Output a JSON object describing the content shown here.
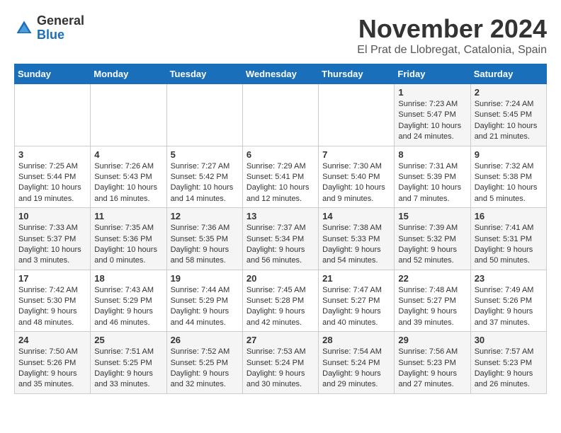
{
  "header": {
    "logo_general": "General",
    "logo_blue": "Blue",
    "month_title": "November 2024",
    "location": "El Prat de Llobregat, Catalonia, Spain"
  },
  "days_of_week": [
    "Sunday",
    "Monday",
    "Tuesday",
    "Wednesday",
    "Thursday",
    "Friday",
    "Saturday"
  ],
  "weeks": [
    [
      {
        "day": "",
        "info": ""
      },
      {
        "day": "",
        "info": ""
      },
      {
        "day": "",
        "info": ""
      },
      {
        "day": "",
        "info": ""
      },
      {
        "day": "",
        "info": ""
      },
      {
        "day": "1",
        "info": "Sunrise: 7:23 AM\nSunset: 5:47 PM\nDaylight: 10 hours and 24 minutes."
      },
      {
        "day": "2",
        "info": "Sunrise: 7:24 AM\nSunset: 5:45 PM\nDaylight: 10 hours and 21 minutes."
      }
    ],
    [
      {
        "day": "3",
        "info": "Sunrise: 7:25 AM\nSunset: 5:44 PM\nDaylight: 10 hours and 19 minutes."
      },
      {
        "day": "4",
        "info": "Sunrise: 7:26 AM\nSunset: 5:43 PM\nDaylight: 10 hours and 16 minutes."
      },
      {
        "day": "5",
        "info": "Sunrise: 7:27 AM\nSunset: 5:42 PM\nDaylight: 10 hours and 14 minutes."
      },
      {
        "day": "6",
        "info": "Sunrise: 7:29 AM\nSunset: 5:41 PM\nDaylight: 10 hours and 12 minutes."
      },
      {
        "day": "7",
        "info": "Sunrise: 7:30 AM\nSunset: 5:40 PM\nDaylight: 10 hours and 9 minutes."
      },
      {
        "day": "8",
        "info": "Sunrise: 7:31 AM\nSunset: 5:39 PM\nDaylight: 10 hours and 7 minutes."
      },
      {
        "day": "9",
        "info": "Sunrise: 7:32 AM\nSunset: 5:38 PM\nDaylight: 10 hours and 5 minutes."
      }
    ],
    [
      {
        "day": "10",
        "info": "Sunrise: 7:33 AM\nSunset: 5:37 PM\nDaylight: 10 hours and 3 minutes."
      },
      {
        "day": "11",
        "info": "Sunrise: 7:35 AM\nSunset: 5:36 PM\nDaylight: 10 hours and 0 minutes."
      },
      {
        "day": "12",
        "info": "Sunrise: 7:36 AM\nSunset: 5:35 PM\nDaylight: 9 hours and 58 minutes."
      },
      {
        "day": "13",
        "info": "Sunrise: 7:37 AM\nSunset: 5:34 PM\nDaylight: 9 hours and 56 minutes."
      },
      {
        "day": "14",
        "info": "Sunrise: 7:38 AM\nSunset: 5:33 PM\nDaylight: 9 hours and 54 minutes."
      },
      {
        "day": "15",
        "info": "Sunrise: 7:39 AM\nSunset: 5:32 PM\nDaylight: 9 hours and 52 minutes."
      },
      {
        "day": "16",
        "info": "Sunrise: 7:41 AM\nSunset: 5:31 PM\nDaylight: 9 hours and 50 minutes."
      }
    ],
    [
      {
        "day": "17",
        "info": "Sunrise: 7:42 AM\nSunset: 5:30 PM\nDaylight: 9 hours and 48 minutes."
      },
      {
        "day": "18",
        "info": "Sunrise: 7:43 AM\nSunset: 5:29 PM\nDaylight: 9 hours and 46 minutes."
      },
      {
        "day": "19",
        "info": "Sunrise: 7:44 AM\nSunset: 5:29 PM\nDaylight: 9 hours and 44 minutes."
      },
      {
        "day": "20",
        "info": "Sunrise: 7:45 AM\nSunset: 5:28 PM\nDaylight: 9 hours and 42 minutes."
      },
      {
        "day": "21",
        "info": "Sunrise: 7:47 AM\nSunset: 5:27 PM\nDaylight: 9 hours and 40 minutes."
      },
      {
        "day": "22",
        "info": "Sunrise: 7:48 AM\nSunset: 5:27 PM\nDaylight: 9 hours and 39 minutes."
      },
      {
        "day": "23",
        "info": "Sunrise: 7:49 AM\nSunset: 5:26 PM\nDaylight: 9 hours and 37 minutes."
      }
    ],
    [
      {
        "day": "24",
        "info": "Sunrise: 7:50 AM\nSunset: 5:26 PM\nDaylight: 9 hours and 35 minutes."
      },
      {
        "day": "25",
        "info": "Sunrise: 7:51 AM\nSunset: 5:25 PM\nDaylight: 9 hours and 33 minutes."
      },
      {
        "day": "26",
        "info": "Sunrise: 7:52 AM\nSunset: 5:25 PM\nDaylight: 9 hours and 32 minutes."
      },
      {
        "day": "27",
        "info": "Sunrise: 7:53 AM\nSunset: 5:24 PM\nDaylight: 9 hours and 30 minutes."
      },
      {
        "day": "28",
        "info": "Sunrise: 7:54 AM\nSunset: 5:24 PM\nDaylight: 9 hours and 29 minutes."
      },
      {
        "day": "29",
        "info": "Sunrise: 7:56 AM\nSunset: 5:23 PM\nDaylight: 9 hours and 27 minutes."
      },
      {
        "day": "30",
        "info": "Sunrise: 7:57 AM\nSunset: 5:23 PM\nDaylight: 9 hours and 26 minutes."
      }
    ]
  ]
}
